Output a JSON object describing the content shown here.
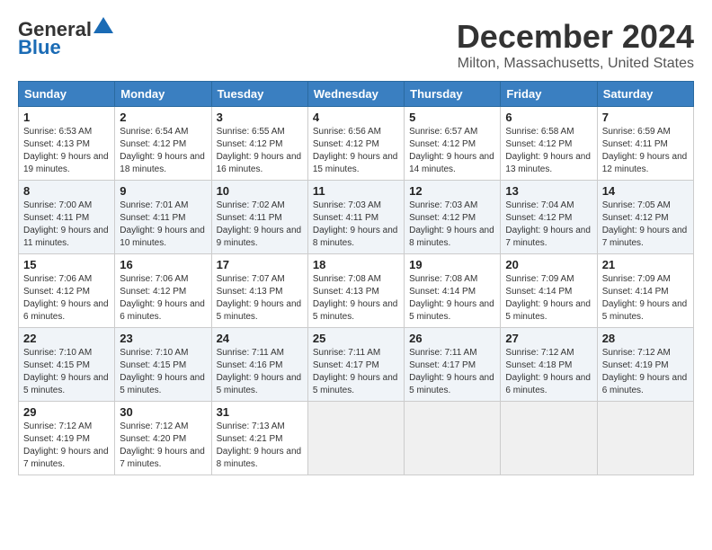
{
  "logo": {
    "general": "General",
    "blue": "Blue"
  },
  "title": "December 2024",
  "location": "Milton, Massachusetts, United States",
  "days_of_week": [
    "Sunday",
    "Monday",
    "Tuesday",
    "Wednesday",
    "Thursday",
    "Friday",
    "Saturday"
  ],
  "weeks": [
    [
      {
        "day": "1",
        "sunrise": "6:53 AM",
        "sunset": "4:13 PM",
        "daylight": "9 hours and 19 minutes."
      },
      {
        "day": "2",
        "sunrise": "6:54 AM",
        "sunset": "4:12 PM",
        "daylight": "9 hours and 18 minutes."
      },
      {
        "day": "3",
        "sunrise": "6:55 AM",
        "sunset": "4:12 PM",
        "daylight": "9 hours and 16 minutes."
      },
      {
        "day": "4",
        "sunrise": "6:56 AM",
        "sunset": "4:12 PM",
        "daylight": "9 hours and 15 minutes."
      },
      {
        "day": "5",
        "sunrise": "6:57 AM",
        "sunset": "4:12 PM",
        "daylight": "9 hours and 14 minutes."
      },
      {
        "day": "6",
        "sunrise": "6:58 AM",
        "sunset": "4:12 PM",
        "daylight": "9 hours and 13 minutes."
      },
      {
        "day": "7",
        "sunrise": "6:59 AM",
        "sunset": "4:11 PM",
        "daylight": "9 hours and 12 minutes."
      }
    ],
    [
      {
        "day": "8",
        "sunrise": "7:00 AM",
        "sunset": "4:11 PM",
        "daylight": "9 hours and 11 minutes."
      },
      {
        "day": "9",
        "sunrise": "7:01 AM",
        "sunset": "4:11 PM",
        "daylight": "9 hours and 10 minutes."
      },
      {
        "day": "10",
        "sunrise": "7:02 AM",
        "sunset": "4:11 PM",
        "daylight": "9 hours and 9 minutes."
      },
      {
        "day": "11",
        "sunrise": "7:03 AM",
        "sunset": "4:11 PM",
        "daylight": "9 hours and 8 minutes."
      },
      {
        "day": "12",
        "sunrise": "7:03 AM",
        "sunset": "4:12 PM",
        "daylight": "9 hours and 8 minutes."
      },
      {
        "day": "13",
        "sunrise": "7:04 AM",
        "sunset": "4:12 PM",
        "daylight": "9 hours and 7 minutes."
      },
      {
        "day": "14",
        "sunrise": "7:05 AM",
        "sunset": "4:12 PM",
        "daylight": "9 hours and 7 minutes."
      }
    ],
    [
      {
        "day": "15",
        "sunrise": "7:06 AM",
        "sunset": "4:12 PM",
        "daylight": "9 hours and 6 minutes."
      },
      {
        "day": "16",
        "sunrise": "7:06 AM",
        "sunset": "4:12 PM",
        "daylight": "9 hours and 6 minutes."
      },
      {
        "day": "17",
        "sunrise": "7:07 AM",
        "sunset": "4:13 PM",
        "daylight": "9 hours and 5 minutes."
      },
      {
        "day": "18",
        "sunrise": "7:08 AM",
        "sunset": "4:13 PM",
        "daylight": "9 hours and 5 minutes."
      },
      {
        "day": "19",
        "sunrise": "7:08 AM",
        "sunset": "4:14 PM",
        "daylight": "9 hours and 5 minutes."
      },
      {
        "day": "20",
        "sunrise": "7:09 AM",
        "sunset": "4:14 PM",
        "daylight": "9 hours and 5 minutes."
      },
      {
        "day": "21",
        "sunrise": "7:09 AM",
        "sunset": "4:14 PM",
        "daylight": "9 hours and 5 minutes."
      }
    ],
    [
      {
        "day": "22",
        "sunrise": "7:10 AM",
        "sunset": "4:15 PM",
        "daylight": "9 hours and 5 minutes."
      },
      {
        "day": "23",
        "sunrise": "7:10 AM",
        "sunset": "4:15 PM",
        "daylight": "9 hours and 5 minutes."
      },
      {
        "day": "24",
        "sunrise": "7:11 AM",
        "sunset": "4:16 PM",
        "daylight": "9 hours and 5 minutes."
      },
      {
        "day": "25",
        "sunrise": "7:11 AM",
        "sunset": "4:17 PM",
        "daylight": "9 hours and 5 minutes."
      },
      {
        "day": "26",
        "sunrise": "7:11 AM",
        "sunset": "4:17 PM",
        "daylight": "9 hours and 5 minutes."
      },
      {
        "day": "27",
        "sunrise": "7:12 AM",
        "sunset": "4:18 PM",
        "daylight": "9 hours and 6 minutes."
      },
      {
        "day": "28",
        "sunrise": "7:12 AM",
        "sunset": "4:19 PM",
        "daylight": "9 hours and 6 minutes."
      }
    ],
    [
      {
        "day": "29",
        "sunrise": "7:12 AM",
        "sunset": "4:19 PM",
        "daylight": "9 hours and 7 minutes."
      },
      {
        "day": "30",
        "sunrise": "7:12 AM",
        "sunset": "4:20 PM",
        "daylight": "9 hours and 7 minutes."
      },
      {
        "day": "31",
        "sunrise": "7:13 AM",
        "sunset": "4:21 PM",
        "daylight": "9 hours and 8 minutes."
      },
      null,
      null,
      null,
      null
    ]
  ]
}
